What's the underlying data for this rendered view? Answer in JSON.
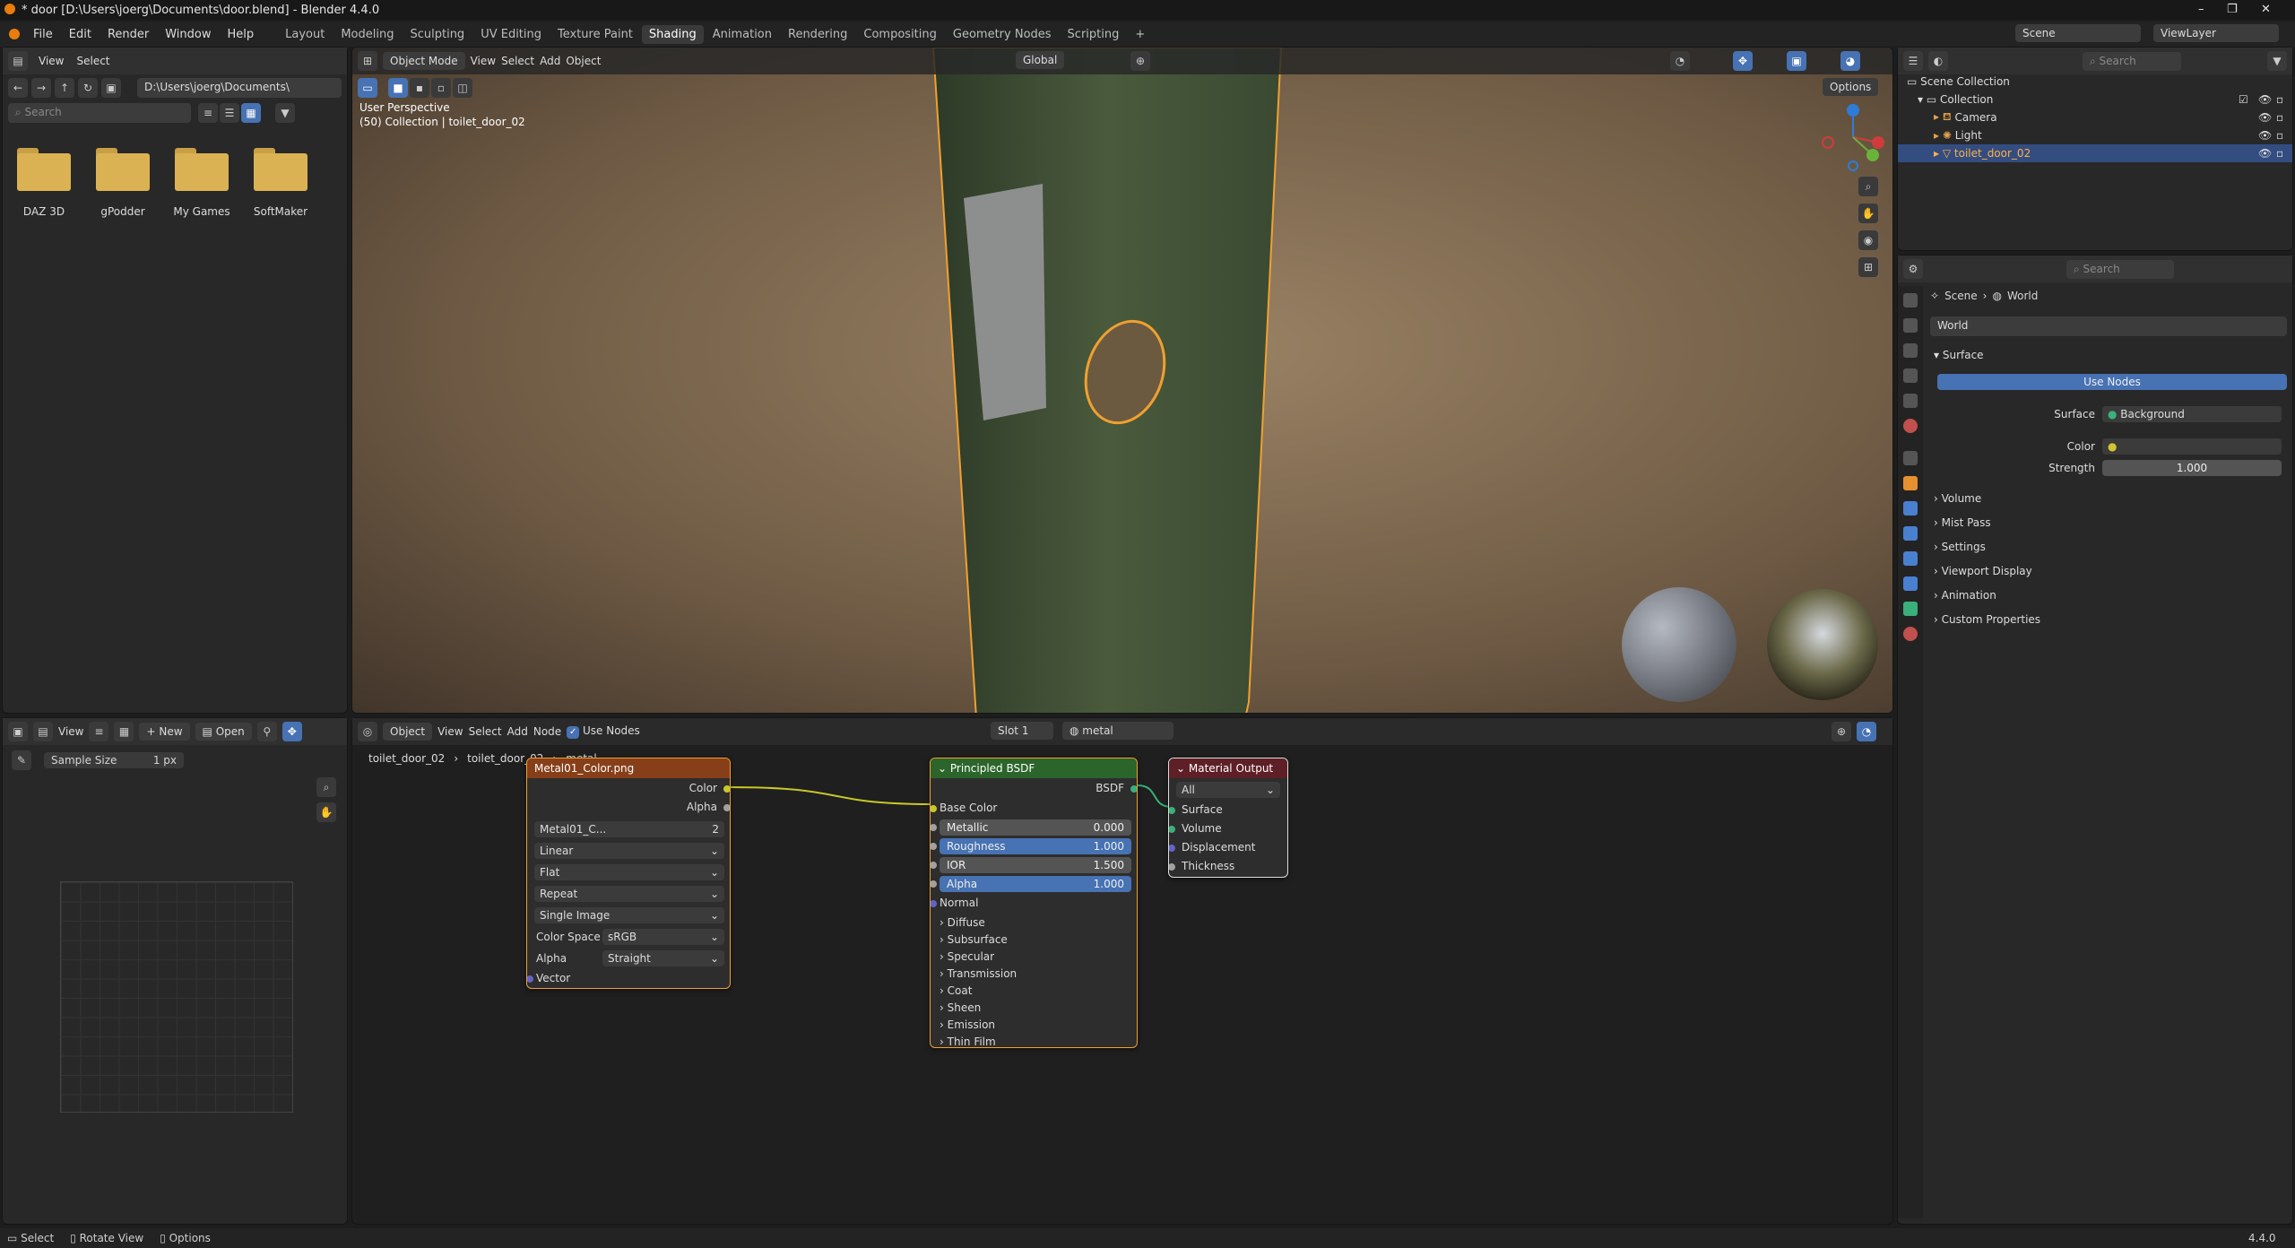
{
  "window": {
    "title": "* door [D:\\Users\\joerg\\Documents\\door.blend] - Blender 4.4.0",
    "minimize": "–",
    "maximize": "❐",
    "close": "✕"
  },
  "menu": [
    "File",
    "Edit",
    "Render",
    "Window",
    "Help"
  ],
  "workspaces": [
    "Layout",
    "Modeling",
    "Sculpting",
    "UV Editing",
    "Texture Paint",
    "Shading",
    "Animation",
    "Rendering",
    "Compositing",
    "Geometry Nodes",
    "Scripting"
  ],
  "active_workspace": "Shading",
  "topright": {
    "scene": "Scene",
    "viewlayer": "ViewLayer"
  },
  "filebrowser": {
    "view": "View",
    "select": "Select",
    "path": "D:\\Users\\joerg\\Documents\\",
    "search_placeholder": "Search",
    "folders": [
      "DAZ 3D",
      "gPodder",
      "My Games",
      "SoftMaker"
    ]
  },
  "viewport": {
    "mode": "Object Mode",
    "view": "View",
    "select": "Select",
    "add": "Add",
    "object": "Object",
    "transform": "Global",
    "options": "Options",
    "overlay_line1": "User Perspective",
    "overlay_line2": "(50) Collection | toilet_door_02"
  },
  "outliner": {
    "search_placeholder": "Search",
    "items": [
      {
        "label": "Scene Collection",
        "indent": 0
      },
      {
        "label": "Collection",
        "indent": 1
      },
      {
        "label": "Camera",
        "indent": 2
      },
      {
        "label": "Light",
        "indent": 2
      },
      {
        "label": "toilet_door_02",
        "indent": 2,
        "selected": true
      }
    ]
  },
  "properties": {
    "search_placeholder": "Search",
    "breadcrumb_scene": "Scene",
    "breadcrumb_world": "World",
    "world_name": "World",
    "surface_header": "Surface",
    "use_nodes": "Use Nodes",
    "surface_label": "Surface",
    "surface_value": "Background",
    "color_label": "Color",
    "strength_label": "Strength",
    "strength_value": "1.000",
    "sections": [
      "Volume",
      "Mist Pass",
      "Settings",
      "Viewport Display",
      "Animation",
      "Custom Properties"
    ]
  },
  "image_editor": {
    "view": "View",
    "new": "New",
    "open": "Open",
    "sample_label": "Sample Size",
    "sample_value": "1 px"
  },
  "node_editor": {
    "object": "Object",
    "view": "View",
    "select": "Select",
    "add": "Add",
    "node": "Node",
    "use_nodes": "Use Nodes",
    "slot": "Slot 1",
    "material": "metal",
    "breadcrumb": [
      "toilet_door_02",
      "toilet_door_02",
      "metal"
    ]
  },
  "node_image": {
    "title": "Metal01_Color.png",
    "out_color": "Color",
    "out_alpha": "Alpha",
    "image_name": "Metal01_C...",
    "users": "2",
    "interp": "Linear",
    "projection": "Flat",
    "extension": "Repeat",
    "source": "Single Image",
    "colorspace_label": "Color Space",
    "colorspace": "sRGB",
    "alpha_label": "Alpha",
    "alpha_value": "Straight",
    "vector": "Vector"
  },
  "node_bsdf": {
    "title": "Principled BSDF",
    "out": "BSDF",
    "base_color": "Base Color",
    "metallic_label": "Metallic",
    "metallic": "0.000",
    "roughness_label": "Roughness",
    "roughness": "1.000",
    "ior_label": "IOR",
    "ior": "1.500",
    "alpha_label": "Alpha",
    "alpha": "1.000",
    "normal": "Normal",
    "panels": [
      "Diffuse",
      "Subsurface",
      "Specular",
      "Transmission",
      "Coat",
      "Sheen",
      "Emission",
      "Thin Film"
    ]
  },
  "node_output": {
    "title": "Material Output",
    "target": "All",
    "inputs": [
      "Surface",
      "Volume",
      "Displacement",
      "Thickness"
    ]
  },
  "status": {
    "select": "Select",
    "rotate": "Rotate View",
    "options": "Options",
    "version": "4.4.0"
  },
  "colors": {
    "accent": "#4772b3",
    "image_node": "#873f19",
    "shader_node": "#2b652b",
    "output_node": "#5e1f26",
    "selection": "#f0a030"
  }
}
